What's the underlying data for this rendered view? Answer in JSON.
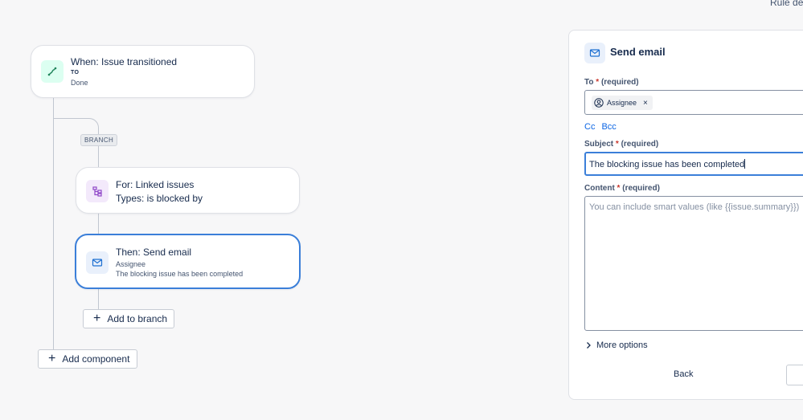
{
  "header": {
    "rule_details_label": "Rule de"
  },
  "trigger": {
    "title": "When: Issue transitioned",
    "label": "TO",
    "value": "Done",
    "icon": "transition-icon",
    "accent": "#1f845a"
  },
  "branch": {
    "tag": "BRANCH"
  },
  "branch_card": {
    "title": "For: Linked issues",
    "subtitle": "Types: is blocked by",
    "icon": "branch-icon",
    "accent": "#8f46c8"
  },
  "action_card": {
    "title": "Then: Send email",
    "line1": "Assignee",
    "line2": "The blocking issue has been completed",
    "icon": "mail-icon",
    "accent": "#1d6fd1"
  },
  "buttons": {
    "add_to_branch": "Add to branch",
    "add_component": "Add component"
  },
  "panel": {
    "title": "Send email",
    "to": {
      "label": "To",
      "required": "(required)",
      "chip": "Assignee"
    },
    "cc": "Cc",
    "bcc": "Bcc",
    "subject": {
      "label": "Subject",
      "required": "(required)",
      "value": "The blocking issue has been completed"
    },
    "content": {
      "label": "Content",
      "required": "(required)",
      "placeholder": "You can include smart values (like {{issue.summary}})"
    },
    "more_options": "More options",
    "back": "Back"
  }
}
